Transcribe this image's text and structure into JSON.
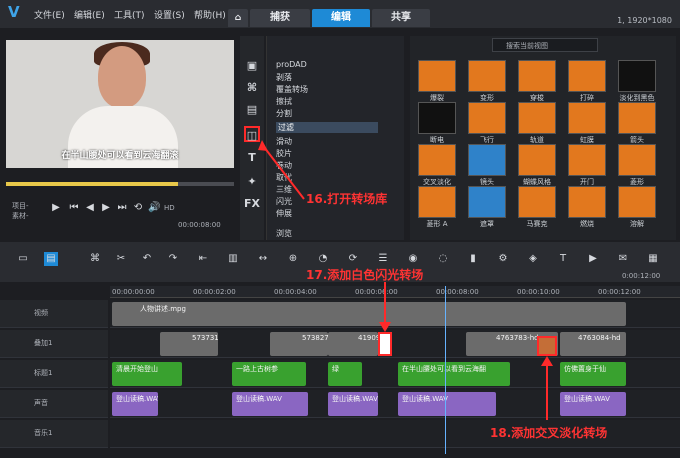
{
  "menubar": {
    "file": "文件(E)",
    "edit": "编辑(E)",
    "tools": "工具(T)",
    "settings": "设置(S)",
    "help": "帮助(H)"
  },
  "tabs": {
    "capture": "捕获",
    "edit": "编辑",
    "share": "共享"
  },
  "resolution": "1, 1920*1080",
  "preview": {
    "caption": "在半山腰处可以看到云海翻滚",
    "project": "项目-",
    "clip": "素材-",
    "hd": "HD",
    "time": "00:00:08:00"
  },
  "categories": [
    "proDAD",
    "剥落",
    "覆盖转场",
    "擦拭",
    "分割",
    "过滤",
    "滑动",
    "胶片",
    "卷动",
    "取代",
    "三维",
    "闪光",
    "伸展",
    "浏览"
  ],
  "search_placeholder": "搜索当前视图",
  "transitions": [
    "爆裂",
    "变形",
    "穿梭",
    "打碎",
    "淡化到黑色",
    "断电",
    "飞行",
    "轨道",
    "虹膜",
    "箭头",
    "交叉淡化",
    "镜头",
    "蝴蝶风格",
    "开门",
    "菱形",
    "菱形 A",
    "遮罩",
    "马赛克",
    "燃烧",
    "溶解"
  ],
  "timeline": {
    "ruler": [
      "00:00:00:00",
      "00:00:02:00",
      "00:00:04:00",
      "00:00:06:00",
      "00:00:08:00",
      "00:00:10:00",
      "00:00:12:00"
    ],
    "tracks": [
      "视频",
      "叠加1",
      "标题1",
      "声音",
      "音乐1"
    ],
    "video_clip": "人物讲述.mpg",
    "overlay_clips": [
      "5737314",
      "5738272",
      "41909",
      "4763783-hd",
      "4763084-hd"
    ],
    "titles": [
      "清晨开始登山",
      "一路上古树参",
      "绿",
      "在半山腰处可以看到云海翻",
      "仿佛置身于仙"
    ],
    "audio_clip": "登山读稿.WAV",
    "time_display": "0:00:12:00"
  },
  "annotations": {
    "step16": "16.打开转场库",
    "step17": "17.添加白色闪光转场",
    "step18": "18.添加交叉淡化转场"
  }
}
